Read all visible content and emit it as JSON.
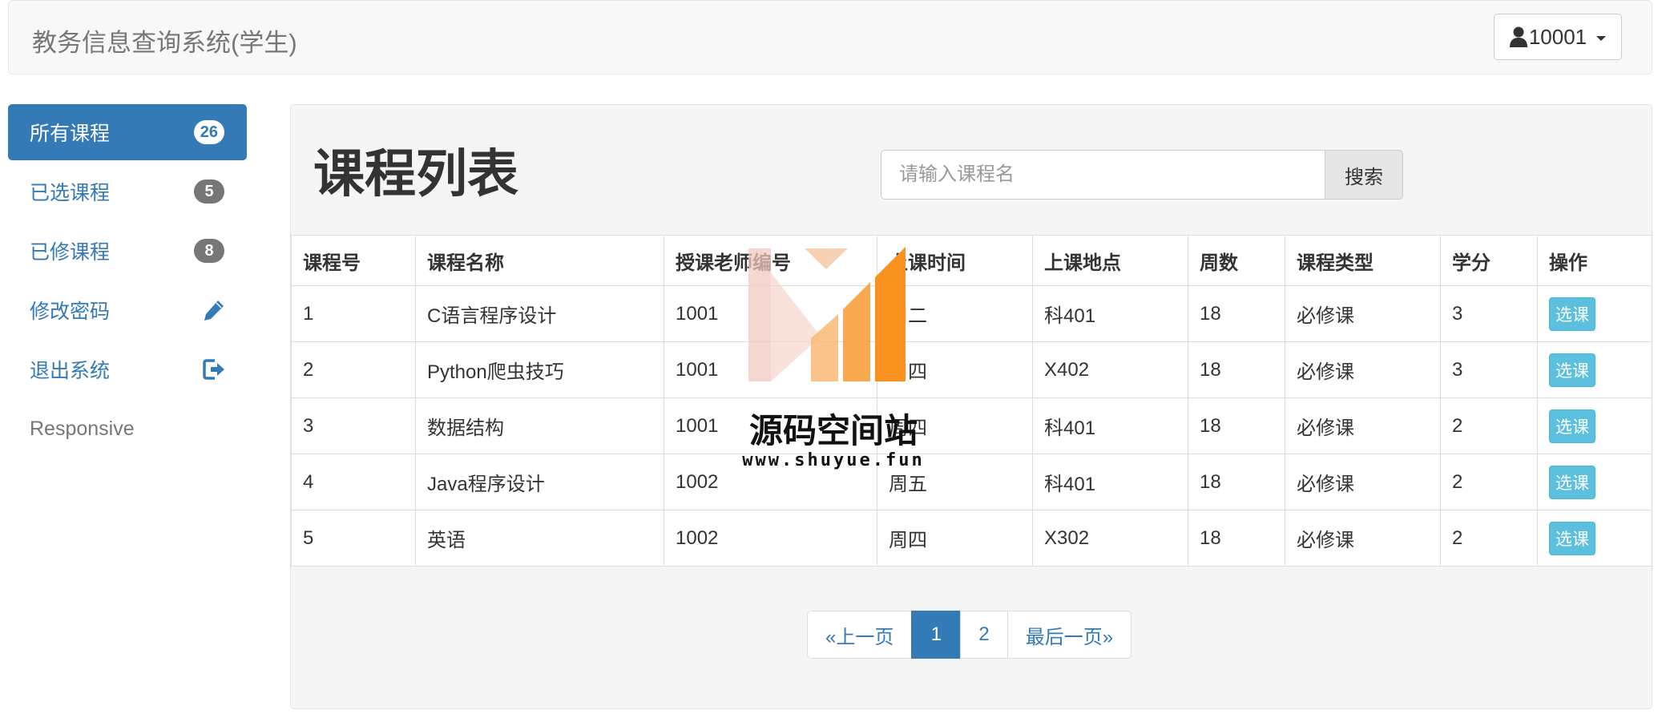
{
  "navbar": {
    "brand": "教务信息查询系统(学生)",
    "user": "10001"
  },
  "sidebar": {
    "items": [
      {
        "label": "所有课程",
        "badge": "26"
      },
      {
        "label": "已选课程",
        "badge": "5"
      },
      {
        "label": "已修课程",
        "badge": "8"
      },
      {
        "label": "修改密码",
        "icon": "pencil-icon"
      },
      {
        "label": "退出系统",
        "icon": "logout-icon"
      },
      {
        "label": "Responsive"
      }
    ]
  },
  "main": {
    "title": "课程列表",
    "search": {
      "placeholder": "请输入课程名",
      "button": "搜索"
    },
    "table": {
      "headers": [
        "课程号",
        "课程名称",
        "授课老师编号",
        "上课时间",
        "上课地点",
        "周数",
        "课程类型",
        "学分",
        "操作"
      ],
      "rows": [
        [
          "1",
          "C语言程序设计",
          "1001",
          "周二",
          "科401",
          "18",
          "必修课",
          "3"
        ],
        [
          "2",
          "Python爬虫技巧",
          "1001",
          "周四",
          "X402",
          "18",
          "必修课",
          "3"
        ],
        [
          "3",
          "数据结构",
          "1001",
          "周四",
          "科401",
          "18",
          "必修课",
          "2"
        ],
        [
          "4",
          "Java程序设计",
          "1002",
          "周五",
          "科401",
          "18",
          "必修课",
          "2"
        ],
        [
          "5",
          "英语",
          "1002",
          "周四",
          "X302",
          "18",
          "必修课",
          "2"
        ]
      ],
      "action_label": "选课"
    },
    "pagination": {
      "prev": "«上一页",
      "pages": [
        "1",
        "2"
      ],
      "current": "1",
      "last": "最后一页»"
    }
  },
  "watermark": {
    "title": "源码空间站",
    "url": "www.shuyue.fun"
  },
  "colors": {
    "primary": "#337ab7",
    "info": "#5bc0de",
    "badge": "#777777",
    "watermark_orange": "#f7931e"
  }
}
